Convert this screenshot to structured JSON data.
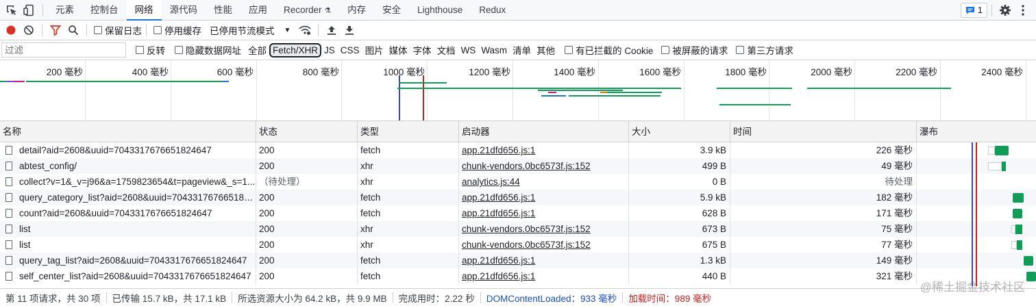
{
  "tabs": [
    "元素",
    "控制台",
    "网络",
    "源代码",
    "性能",
    "应用",
    "Recorder",
    "内存",
    "安全",
    "Lighthouse",
    "Redux"
  ],
  "active_tab": "网络",
  "issues_count": "1",
  "toolbar": {
    "preserve_log": "保留日志",
    "disable_cache": "停用缓存",
    "throttling": "已停用节流模式"
  },
  "filter": {
    "placeholder": "过滤",
    "invert": "反转",
    "hide_data_urls": "隐藏数据网址",
    "types": [
      "全部",
      "Fetch/XHR",
      "JS",
      "CSS",
      "图片",
      "媒体",
      "字体",
      "文档",
      "WS",
      "Wasm",
      "清单",
      "其他"
    ],
    "selected_type": "Fetch/XHR",
    "blocked_cookies": "有已拦截的 Cookie",
    "blocked_requests": "被屏蔽的请求",
    "third_party": "第三方请求"
  },
  "overview_ticks": [
    "200 毫秒",
    "400 毫秒",
    "600 毫秒",
    "800 毫秒",
    "1000 毫秒",
    "1200 毫秒",
    "1400 毫秒",
    "1600 毫秒",
    "1800 毫秒",
    "2000 毫秒",
    "2200 毫秒",
    "2400 毫秒"
  ],
  "columns": [
    "名称",
    "状态",
    "类型",
    "启动器",
    "大小",
    "时间",
    "瀑布"
  ],
  "rows": [
    {
      "name": "detail?aid=2608&uuid=7043317676651824647",
      "status": "200",
      "type": "fetch",
      "initiator": "app.21dfd656.js:1",
      "size": "3.9 kB",
      "time": "226 毫秒"
    },
    {
      "name": "abtest_config/",
      "status": "200",
      "type": "xhr",
      "initiator": "chunk-vendors.0bc6573f.js:152",
      "size": "499 B",
      "time": "49 毫秒"
    },
    {
      "name": "collect?v=1&_v=j96&a=1759823654&t=pageview&_s=1...",
      "status": "（待处理）",
      "type": "xhr",
      "initiator": "analytics.js:44",
      "size": "0 B",
      "time": "待处理"
    },
    {
      "name": "query_category_list?aid=2608&uuid=704331767665182...",
      "status": "200",
      "type": "fetch",
      "initiator": "app.21dfd656.js:1",
      "size": "5.9 kB",
      "time": "182 毫秒"
    },
    {
      "name": "count?aid=2608&uuid=7043317676651824647",
      "status": "200",
      "type": "fetch",
      "initiator": "app.21dfd656.js:1",
      "size": "628 B",
      "time": "171 毫秒"
    },
    {
      "name": "list",
      "status": "200",
      "type": "xhr",
      "initiator": "chunk-vendors.0bc6573f.js:152",
      "size": "673 B",
      "time": "75 毫秒"
    },
    {
      "name": "list",
      "status": "200",
      "type": "xhr",
      "initiator": "chunk-vendors.0bc6573f.js:152",
      "size": "675 B",
      "time": "77 毫秒"
    },
    {
      "name": "query_tag_list?aid=2608&uuid=7043317676651824647",
      "status": "200",
      "type": "fetch",
      "initiator": "app.21dfd656.js:1",
      "size": "1.3 kB",
      "time": "149 毫秒"
    },
    {
      "name": "self_center_list?aid=2608&uuid=7043317676651824647",
      "status": "200",
      "type": "fetch",
      "initiator": "app.21dfd656.js:1",
      "size": "440 B",
      "time": "321 毫秒"
    }
  ],
  "status": {
    "requests": "第 11 项请求，共 30 项",
    "transferred": "已传输 15.7 kB，共 17.1 kB",
    "resources": "所选资源大小为 64.2 kB，共 9.9 MB",
    "finish": "完成用时：2.22 秒",
    "dcl": "DOMContentLoaded：933 毫秒",
    "load": "加载时间：989 毫秒"
  },
  "watermark": "@稀土掘金技术社区",
  "colors": {
    "accent": "#1a73e8",
    "record": "#d93025",
    "waterfall_green": "#0f9d58",
    "dcl": "#1a4fc4",
    "load": "#c5221f"
  }
}
